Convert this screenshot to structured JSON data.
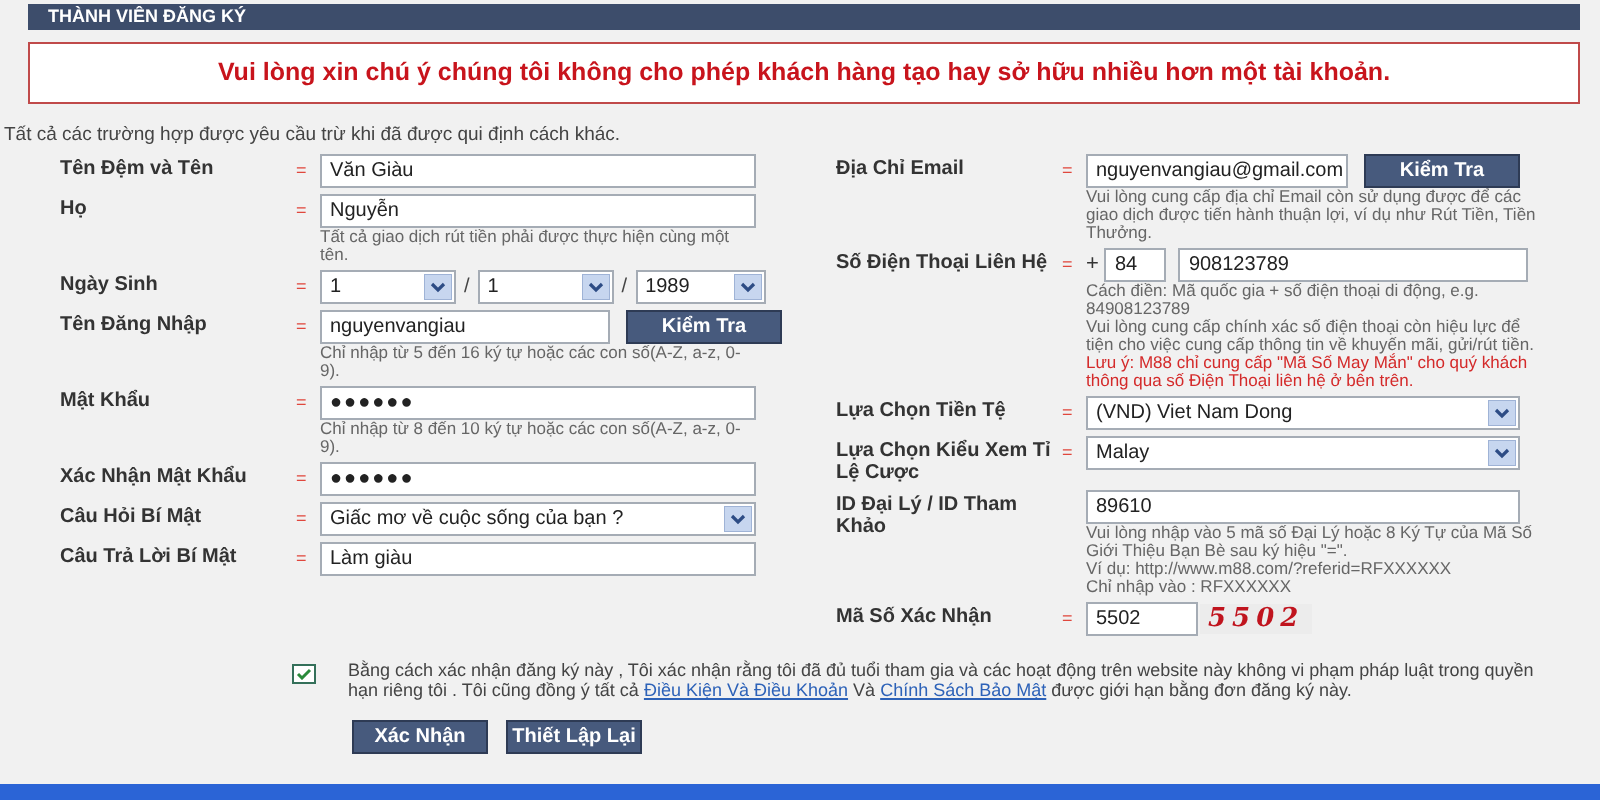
{
  "header": {
    "title": "THÀNH VIÊN ĐĂNG KÝ"
  },
  "notice": "Vui lòng xin chú ý chúng tôi không cho phép khách hàng tạo hay sở hữu nhiều hơn một tài khoản.",
  "intro": "Tất cả các trường hợp được yêu cầu trừ khi đã được qui định cách khác.",
  "left_fields": [
    {
      "kind": "text",
      "label": "Tên Đệm và Tên",
      "required": true,
      "value": "Văn Giàu"
    },
    {
      "kind": "text",
      "label": "Họ",
      "required": true,
      "value": "Nguyễn",
      "notes": [
        {
          "text": "Tất cả giao dịch rút tiền phải được thực hiện cùng một tên.",
          "warning": false
        }
      ]
    },
    {
      "kind": "date",
      "label": "Ngày Sinh",
      "required": true,
      "parts": [
        "1",
        "1",
        "1989"
      ],
      "separator": "/"
    },
    {
      "kind": "text_button",
      "label": "Tên Đăng Nhập",
      "required": true,
      "value": "nguyenvangiau",
      "button": "Kiểm Tra",
      "notes": [
        {
          "text": "Chỉ nhập từ 5 đến 16 ký tự hoặc các con số(A-Z, a-z, 0-9).",
          "warning": false
        }
      ]
    },
    {
      "kind": "password",
      "label": "Mật Khẩu",
      "required": true,
      "value": "●●●●●●",
      "notes": [
        {
          "text": "Chỉ nhập từ 8 đến 10 ký tự hoặc các con số(A-Z, a-z, 0-9).",
          "warning": false
        }
      ]
    },
    {
      "kind": "password",
      "label": "Xác Nhận Mật Khẩu",
      "required": true,
      "value": "●●●●●●"
    },
    {
      "kind": "select",
      "label": "Câu Hỏi Bí Mật",
      "required": true,
      "value": "Giấc mơ về cuộc sống của bạn ?"
    },
    {
      "kind": "text",
      "label": "Câu Trả Lời Bí Mật",
      "required": true,
      "value": "Làm giàu"
    }
  ],
  "right_fields": [
    {
      "kind": "text_button",
      "label": "Địa Chỉ Email",
      "required": true,
      "value": "nguyenvangiau@gmail.com",
      "button": "Kiểm Tra",
      "notes": [
        {
          "text": "Vui lòng cung cấp địa chỉ Email còn sử dụng được để các giao dịch được tiến hành thuận lợi, ví dụ như Rút Tiền, Tiền Thưởng.",
          "warning": false
        }
      ]
    },
    {
      "kind": "phone",
      "label": "Số Điện Thoại Liên Hệ",
      "required": true,
      "prefix": "+",
      "country_code": "84",
      "value": "908123789",
      "notes": [
        {
          "text": "Cách điền: Mã quốc gia + số điện thoại di động, e.g. 84908123789",
          "warning": false
        },
        {
          "text": "Vui lòng cung cấp chính xác số điện thoại còn hiệu lực để tiện cho việc cung cấp thông tin về khuyến mãi, gửi/rút tiền.",
          "warning": false
        },
        {
          "text": "Lưu ý: M88 chỉ cung cấp \"Mã Số May Mắn\" cho quý khách thông qua số Điện Thoại liên hệ ở bên trên.",
          "warning": true
        }
      ]
    },
    {
      "kind": "select",
      "label": "Lựa Chọn Tiền Tệ",
      "required": true,
      "value": "(VND) Viet Nam Dong"
    },
    {
      "kind": "select",
      "label": "Lựa Chọn Kiểu Xem Tỉ Lệ Cược",
      "required": true,
      "value": "Malay"
    },
    {
      "kind": "text",
      "label": "ID Đại Lý / ID Tham Khảo",
      "required": false,
      "value": "89610",
      "notes": [
        {
          "text": "Vui lòng nhập vào 5 mã số Đại Lý hoặc 8 Ký Tự của Mã Số Giới Thiệu Bạn Bè sau ký hiệu \"=\".",
          "warning": false
        },
        {
          "text": "Ví dụ: http://www.m88.com/?referid=RFXXXXXX",
          "warning": false
        },
        {
          "text": "Chỉ nhập vào : RFXXXXXX",
          "warning": false
        }
      ]
    },
    {
      "kind": "captcha",
      "label": "Mã Số Xác Nhận",
      "required": true,
      "value": "5502",
      "captcha": "5502"
    }
  ],
  "required_mark": "=",
  "agreement": {
    "checked": true,
    "text_before": "Bằng cách xác nhận đăng ký này , Tôi xác nhận rằng tôi đã đủ tuổi tham gia và các hoạt động trên website này không vi phạm pháp luật trong quyền hạn riêng tôi . Tôi cũng đồng ý tất cả",
    "link1": "Điều Kiện Và Điều Khoản",
    "middle": "Và",
    "link2": "Chính Sách Bảo Mật",
    "text_after": "được giới hạn bằng đơn đăng ký này."
  },
  "buttons": [
    "Xác Nhận",
    "Thiết Lập Lại"
  ]
}
